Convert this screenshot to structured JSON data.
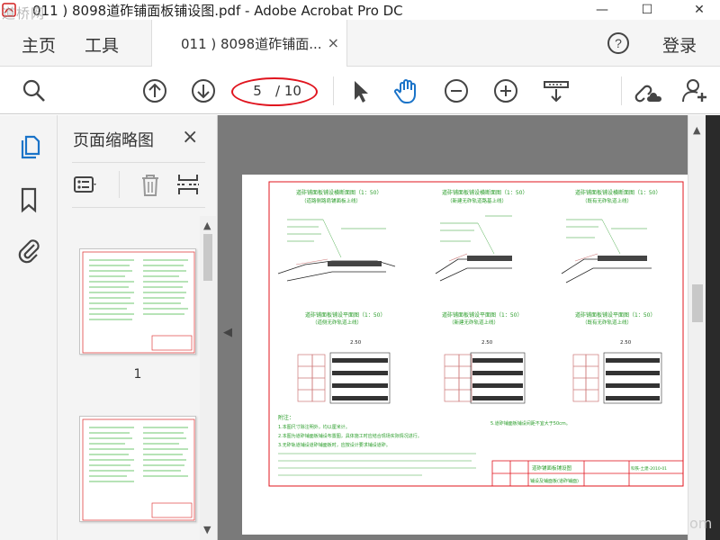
{
  "window": {
    "title": "011 ) 8098道砟铺面板铺设图.pdf - Adobe Acrobat Pro DC",
    "watermark": "道桥网",
    "min_glyph": "—",
    "max_glyph": "☐",
    "close_glyph": "✕"
  },
  "menubar": {
    "home_label": "主页",
    "tools_label": "工具",
    "tab_label": "011 ) 8098道砟铺面...",
    "tab_close": "×",
    "signin_label": "登录"
  },
  "toolbar": {
    "page_current": "5",
    "page_total": "/ 10",
    "highlight_color": "#e0141e"
  },
  "thumbnail_panel": {
    "title": "页面缩略图",
    "close_glyph": "×",
    "pages": [
      {
        "label": "1"
      },
      {
        "label": ""
      }
    ]
  },
  "document": {
    "sections_top": [
      {
        "title": "道砟铺面板铺设横断面图（1：50）",
        "subtitle": "（道路侧路肩铺面板上线）"
      },
      {
        "title": "道砟铺面板铺设横断面图（1：50）",
        "subtitle": "（新建无砟轨道路基上线）"
      },
      {
        "title": "道砟铺面板铺设横断面图（1：50）",
        "subtitle": "（既有无砟轨道上线）"
      }
    ],
    "sections_mid": [
      {
        "title": "道砟铺面板铺设平面图（1：50）",
        "subtitle": "（道侧无砟轨道上线）"
      },
      {
        "title": "道砟铺面板铺设平面图（1：50）",
        "subtitle": "（新建无砟轨道上线）"
      },
      {
        "title": "道砟铺面板铺设平面图（1：50）",
        "subtitle": "（既有无砟轨道上线）"
      }
    ],
    "notes_title": "附注：",
    "notes": [
      "1.本图尺寸除注明外，均以厘米计。",
      "2.本图为道砟铺面板铺设布置图，具体施工时应结合现场实际情况进行。",
      "3.无砟轨道铺设道砟铺面板时，应按设计要求铺设道砟。"
    ],
    "right_note": "5.道砟铺面板铺设间距不宜大于50cm。",
    "dim_labels": [
      "2.50",
      "2.50",
      "2.50"
    ],
    "titleblock_name": "道砟铺面板铺设图",
    "titleblock_sub": "铺设及铺面板(道砟铺面)",
    "titleblock_code": "科铁-土建-2010-01"
  },
  "corner_text": "om"
}
